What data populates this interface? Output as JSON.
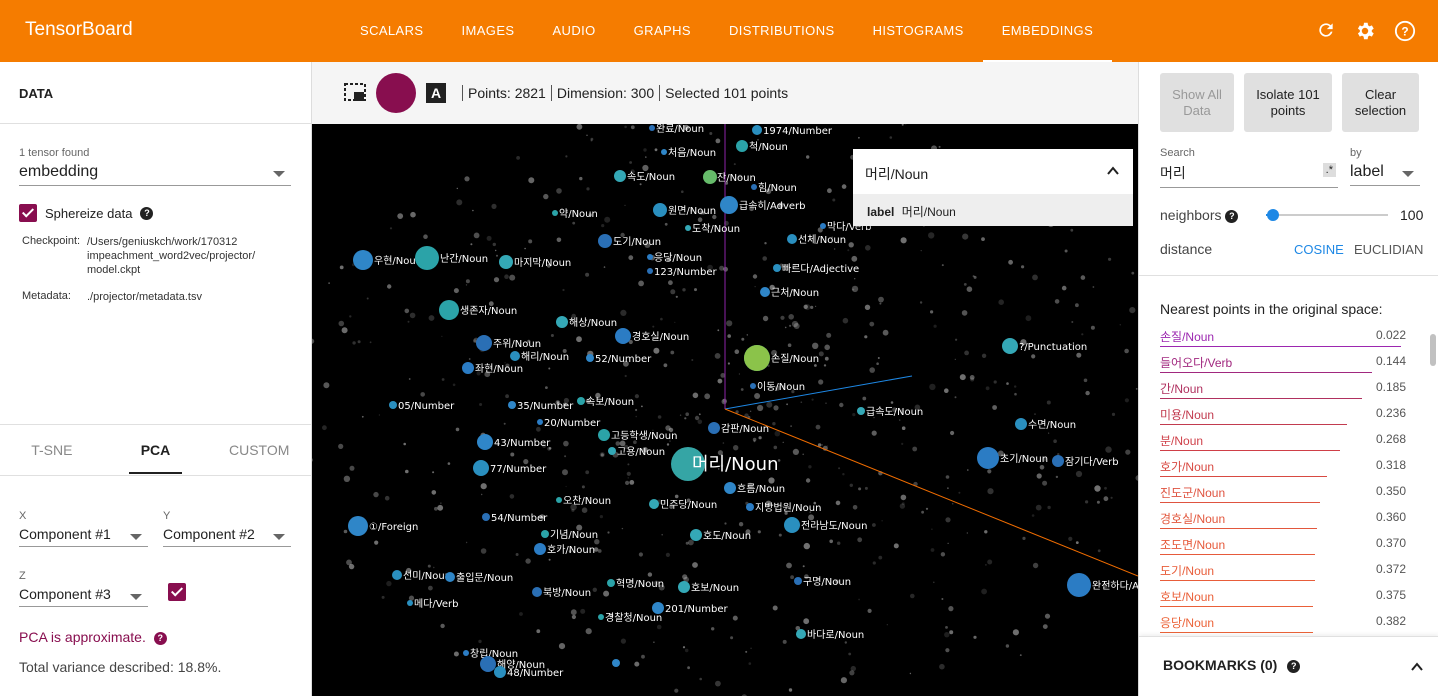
{
  "app": {
    "title": "TensorBoard",
    "tabs": [
      "SCALARS",
      "IMAGES",
      "AUDIO",
      "GRAPHS",
      "DISTRIBUTIONS",
      "HISTOGRAMS",
      "EMBEDDINGS"
    ],
    "active_tab": "EMBEDDINGS",
    "accent_color": "#f57c00"
  },
  "left": {
    "header": "DATA",
    "tensor_found": "1 tensor found",
    "tensor_selected": "embedding",
    "sphereize_label": "Sphereize data",
    "checkpoint_label": "Checkpoint:",
    "checkpoint_value": "/Users/geniuskch/work/170312 impeachment_word2vec/projector/ model.ckpt",
    "metadata_label": "Metadata:",
    "metadata_value": "./projector/metadata.tsv",
    "projection_tabs": [
      "T-SNE",
      "PCA",
      "CUSTOM"
    ],
    "active_projection": "PCA",
    "x_label": "X",
    "x_value": "Component #1",
    "y_label": "Y",
    "y_value": "Component #2",
    "z_label": "Z",
    "z_value": "Component #3",
    "pca_note": "PCA is approximate.",
    "variance": "Total variance described: 18.8%."
  },
  "toolbar": {
    "points": "Points: 2821",
    "dimension": "Dimension: 300",
    "selected": "Selected 101 points"
  },
  "search_popup": {
    "title": "머리/Noun",
    "label_key": "label",
    "label_value": "머리/Noun"
  },
  "canvas": {
    "center_label": "머리/Noun",
    "labels": [
      "완료/Noun",
      "1974/Number",
      "처음/Noun",
      "척/Noun",
      "속도/Noun",
      "잔/Noun",
      "힘/Noun",
      "원면/Noun",
      "급속히/Adverb",
      "약/Noun",
      "도착/Noun",
      "막다/Verb",
      "도기/Noun",
      "선체/Noun",
      "우현/Noun",
      "난간/Noun",
      "마지막/Noun",
      "응당/Noun",
      "123/Number",
      "빠르다/Adjective",
      "근처/Noun",
      "생존자/Noun",
      "해상/Noun",
      "경호실/Noun",
      "주위/Noun",
      "해리/Noun",
      "52/Number",
      "손질/Noun",
      "?/Punctuation",
      "좌현/Noun",
      "이동/Noun",
      "05/Number",
      "35/Number",
      "속보/Noun",
      "급속도/Noun",
      "20/Number",
      "감판/Noun",
      "수면/Noun",
      "43/Number",
      "고등학생/Noun",
      "고용/Noun",
      "초기/Noun",
      "잠기다/Verb",
      "77/Number",
      "흐름/Noun",
      "오찬/Noun",
      "민주당/Noun",
      "지방법원/Noun",
      "54/Number",
      "전라남도/Noun",
      "①/Foreign",
      "기념/Noun",
      "호도/Noun",
      "호가/Noun",
      "구명/Noun",
      "선미/Noun",
      "출입문/Noun",
      "혁명/Noun",
      "호보/Noun",
      "완전하다/Adje",
      "북방/Noun",
      "메다/Verb",
      "201/Number",
      "경찰청/Noun",
      "바다로/Noun",
      "창립/Noun",
      "해양/Noun",
      "48/Number"
    ]
  },
  "right": {
    "show_all": "Show All Data",
    "isolate": "Isolate 101 points",
    "clear": "Clear selection",
    "search_label": "Search",
    "search_value": "머리",
    "regex_badge": ".*",
    "by_label": "by",
    "by_value": "label",
    "neighbors_label": "neighbors",
    "neighbors_value": "100",
    "neighbors_fraction": 0.06,
    "distance_label": "distance",
    "cosine": "COSINE",
    "euclidian": "EUCLIDIAN",
    "nearest_title": "Nearest points in the original space:",
    "nearest": [
      {
        "label": "손질/Noun",
        "value": "0.022",
        "color": "#9c27b0",
        "score": 0.98
      },
      {
        "label": "들어오다/Verb",
        "value": "0.144",
        "color": "#a1287f",
        "score": 0.86
      },
      {
        "label": "간/Noun",
        "value": "0.185",
        "color": "#b0305f",
        "score": 0.82
      },
      {
        "label": "미용/Noun",
        "value": "0.236",
        "color": "#c23b4f",
        "score": 0.76
      },
      {
        "label": "분/Noun",
        "value": "0.268",
        "color": "#cf3f48",
        "score": 0.73
      },
      {
        "label": "호가/Noun",
        "value": "0.318",
        "color": "#d84a42",
        "score": 0.68
      },
      {
        "label": "진도군/Noun",
        "value": "0.350",
        "color": "#df5340",
        "score": 0.65
      },
      {
        "label": "경호실/Noun",
        "value": "0.360",
        "color": "#e2573d",
        "score": 0.64
      },
      {
        "label": "조도면/Noun",
        "value": "0.370",
        "color": "#e65a3b",
        "score": 0.63
      },
      {
        "label": "도기/Noun",
        "value": "0.372",
        "color": "#e85d3a",
        "score": 0.63
      },
      {
        "label": "호보/Noun",
        "value": "0.375",
        "color": "#ea6039",
        "score": 0.62
      },
      {
        "label": "응당/Noun",
        "value": "0.382",
        "color": "#ec6338",
        "score": 0.62
      }
    ],
    "bookmarks": "BOOKMARKS (0)"
  }
}
